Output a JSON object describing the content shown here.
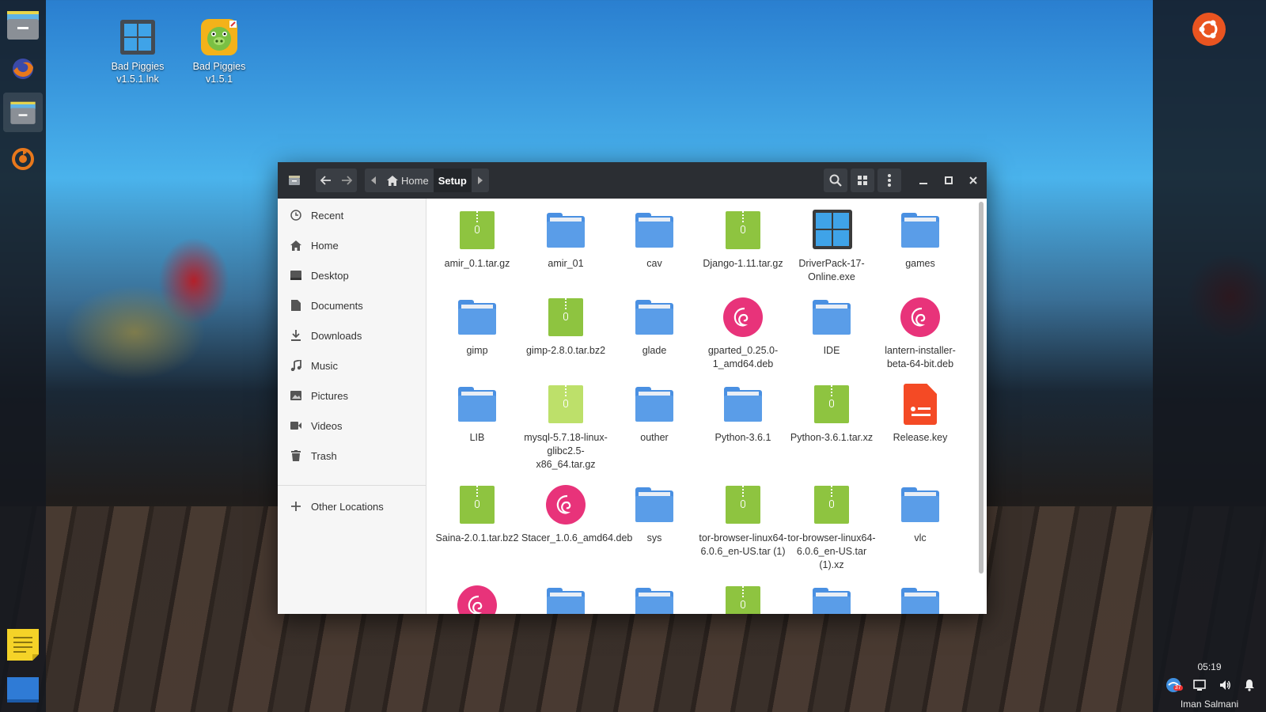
{
  "desktop": {
    "icons": [
      {
        "label": "Bad Piggies v1.5.1.lnk",
        "icon": "windows-shortcut-icon"
      },
      {
        "label": "Bad Piggies v1.5.1",
        "icon": "bad-piggies-icon"
      }
    ]
  },
  "dock": {
    "items": [
      "file-manager-icon",
      "firefox-icon",
      "file-manager-icon",
      "software-updater-icon",
      "sticky-notes-icon",
      "show-desktop-icon"
    ]
  },
  "panel": {
    "time": "05:19",
    "user": "Iman Salmani",
    "notification_count": "37"
  },
  "window": {
    "breadcrumb": {
      "home": "Home",
      "current": "Setup"
    },
    "sidebar": {
      "items": [
        {
          "label": "Recent",
          "icon": "clock-icon"
        },
        {
          "label": "Home",
          "icon": "home-icon"
        },
        {
          "label": "Desktop",
          "icon": "desktop-icon"
        },
        {
          "label": "Documents",
          "icon": "document-icon"
        },
        {
          "label": "Downloads",
          "icon": "download-icon"
        },
        {
          "label": "Music",
          "icon": "music-icon"
        },
        {
          "label": "Pictures",
          "icon": "picture-icon"
        },
        {
          "label": "Videos",
          "icon": "video-icon"
        },
        {
          "label": "Trash",
          "icon": "trash-icon"
        }
      ],
      "other": {
        "label": "Other Locations",
        "icon": "plus-icon"
      }
    },
    "files": [
      {
        "name": "amir_0.1.tar.gz",
        "type": "archive"
      },
      {
        "name": "amir_01",
        "type": "folder"
      },
      {
        "name": "cav",
        "type": "folder"
      },
      {
        "name": "Django-1.11.tar.gz",
        "type": "archive"
      },
      {
        "name": "DriverPack-17-Online.exe",
        "type": "exe"
      },
      {
        "name": "games",
        "type": "folder"
      },
      {
        "name": "gimp",
        "type": "folder"
      },
      {
        "name": "gimp-2.8.0.tar.bz2",
        "type": "archive"
      },
      {
        "name": "glade",
        "type": "folder"
      },
      {
        "name": "gparted_0.25.0-1_amd64.deb",
        "type": "deb"
      },
      {
        "name": "IDE",
        "type": "folder"
      },
      {
        "name": "lantern-installer-beta-64-bit.deb",
        "type": "deb"
      },
      {
        "name": "LIB",
        "type": "folder"
      },
      {
        "name": "mysql-5.7.18-linux-glibc2.5-x86_64.tar.gz",
        "type": "archive-light"
      },
      {
        "name": "outher",
        "type": "folder"
      },
      {
        "name": "Python-3.6.1",
        "type": "folder"
      },
      {
        "name": "Python-3.6.1.tar.xz",
        "type": "archive"
      },
      {
        "name": "Release.key",
        "type": "key"
      },
      {
        "name": "Saina-2.0.1.tar.bz2",
        "type": "archive"
      },
      {
        "name": "Stacer_1.0.6_amd64.deb",
        "type": "deb"
      },
      {
        "name": "sys",
        "type": "folder"
      },
      {
        "name": "tor-browser-linux64-6.0.6_en-US.tar (1)",
        "type": "archive"
      },
      {
        "name": "tor-browser-linux64-6.0.6_en-US.tar (1).xz",
        "type": "archive"
      },
      {
        "name": "vlc",
        "type": "folder"
      },
      {
        "name": "",
        "type": "deb"
      },
      {
        "name": "",
        "type": "folder"
      },
      {
        "name": "",
        "type": "folder"
      },
      {
        "name": "",
        "type": "archive"
      },
      {
        "name": "",
        "type": "folder"
      },
      {
        "name": "",
        "type": "folder"
      }
    ]
  }
}
